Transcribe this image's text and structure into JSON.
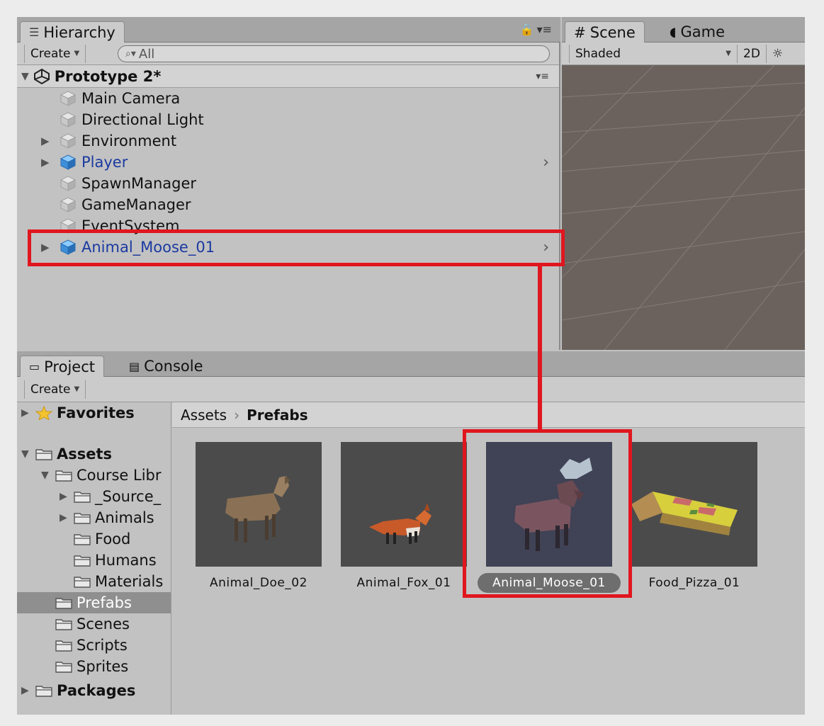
{
  "hierarchy": {
    "tab_label": "Hierarchy",
    "create_label": "Create",
    "search_placeholder": "All",
    "scene_name": "Prototype 2*",
    "items": [
      {
        "label": "Main Camera",
        "prefab": false,
        "expandable": false
      },
      {
        "label": "Directional Light",
        "prefab": false,
        "expandable": false
      },
      {
        "label": "Environment",
        "prefab": false,
        "expandable": true
      },
      {
        "label": "Player",
        "prefab": true,
        "expandable": true
      },
      {
        "label": "SpawnManager",
        "prefab": false,
        "expandable": false
      },
      {
        "label": "GameManager",
        "prefab": false,
        "expandable": false
      },
      {
        "label": "EventSystem",
        "prefab": false,
        "expandable": false
      },
      {
        "label": "Animal_Moose_01",
        "prefab": true,
        "expandable": true
      }
    ]
  },
  "scene": {
    "tabs": [
      "Scene",
      "Game"
    ],
    "shading_mode": "Shaded",
    "mode_2d": "2D"
  },
  "project": {
    "tabs": [
      "Project",
      "Console"
    ],
    "create_label": "Create",
    "tree": [
      {
        "label": "Favorites",
        "bold": true,
        "icon": "star-icon"
      },
      {
        "label": "Assets",
        "bold": true,
        "icon": "folder-icon"
      },
      {
        "label": "Course Libr",
        "bold": false,
        "icon": "folder-icon"
      },
      {
        "label": "_Source_",
        "bold": false,
        "icon": "folder-icon"
      },
      {
        "label": "Animals",
        "bold": false,
        "icon": "folder-icon"
      },
      {
        "label": "Food",
        "bold": false,
        "icon": "folder-icon"
      },
      {
        "label": "Humans",
        "bold": false,
        "icon": "folder-icon"
      },
      {
        "label": "Materials",
        "bold": false,
        "icon": "folder-icon"
      },
      {
        "label": "Prefabs",
        "bold": false,
        "icon": "folder-icon",
        "selected": true
      },
      {
        "label": "Scenes",
        "bold": false,
        "icon": "folder-icon"
      },
      {
        "label": "Scripts",
        "bold": false,
        "icon": "folder-icon"
      },
      {
        "label": "Sprites",
        "bold": false,
        "icon": "folder-icon"
      },
      {
        "label": "Packages",
        "bold": true,
        "icon": "folder-icon"
      }
    ],
    "breadcrumb": [
      "Assets",
      "Prefabs"
    ],
    "assets": [
      "Animal_Doe_02",
      "Animal_Fox_01",
      "Animal_Moose_01",
      "Food_Pizza_01"
    ],
    "selected_asset": "Animal_Moose_01"
  },
  "colors": {
    "highlight": "#e0161f",
    "prefab_text": "#1b3aa0"
  }
}
